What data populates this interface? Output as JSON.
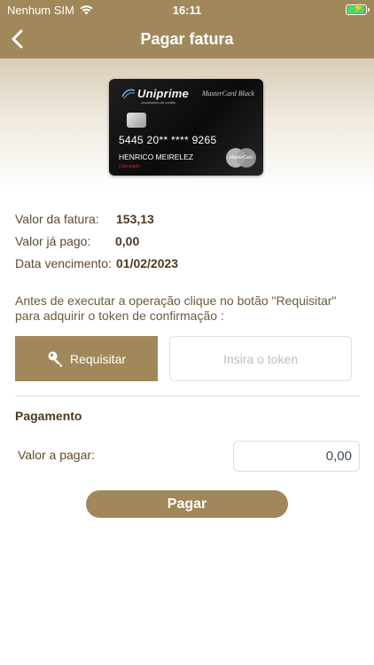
{
  "status_bar": {
    "carrier": "Nenhum SIM",
    "time": "16:11"
  },
  "nav": {
    "title": "Pagar fatura",
    "back_icon": "chevron-left-icon"
  },
  "card": {
    "issuer": "Uniprime",
    "issuer_tagline": "cooperativa de crédito",
    "brand_line": "MasterCard Black",
    "number": "5445 20** **** 9265",
    "holder": "HENRICO MEIRELEZ",
    "status": "Cancelado",
    "network": "MasterCard"
  },
  "invoice": {
    "amount_label": "Valor da fatura:",
    "amount_value": "153,13",
    "paid_label": "Valor já pago:",
    "paid_value": "0,00",
    "due_label": "Data vencimento:",
    "due_value": "01/02/2023"
  },
  "token": {
    "instructions": "Antes de executar a operação clique no botão \"Requisitar\" para adquirir o token de confirmação :",
    "request_label": "Requisitar",
    "request_icon": "key-icon",
    "input_placeholder": "Insira o token"
  },
  "payment": {
    "section_title": "Pagamento",
    "amount_label": "Valor a pagar:",
    "amount_value": "0,00",
    "submit_label": "Pagar"
  },
  "colors": {
    "primary": "#a0885b",
    "text": "#5b4a2e",
    "battery": "#4cd964"
  }
}
